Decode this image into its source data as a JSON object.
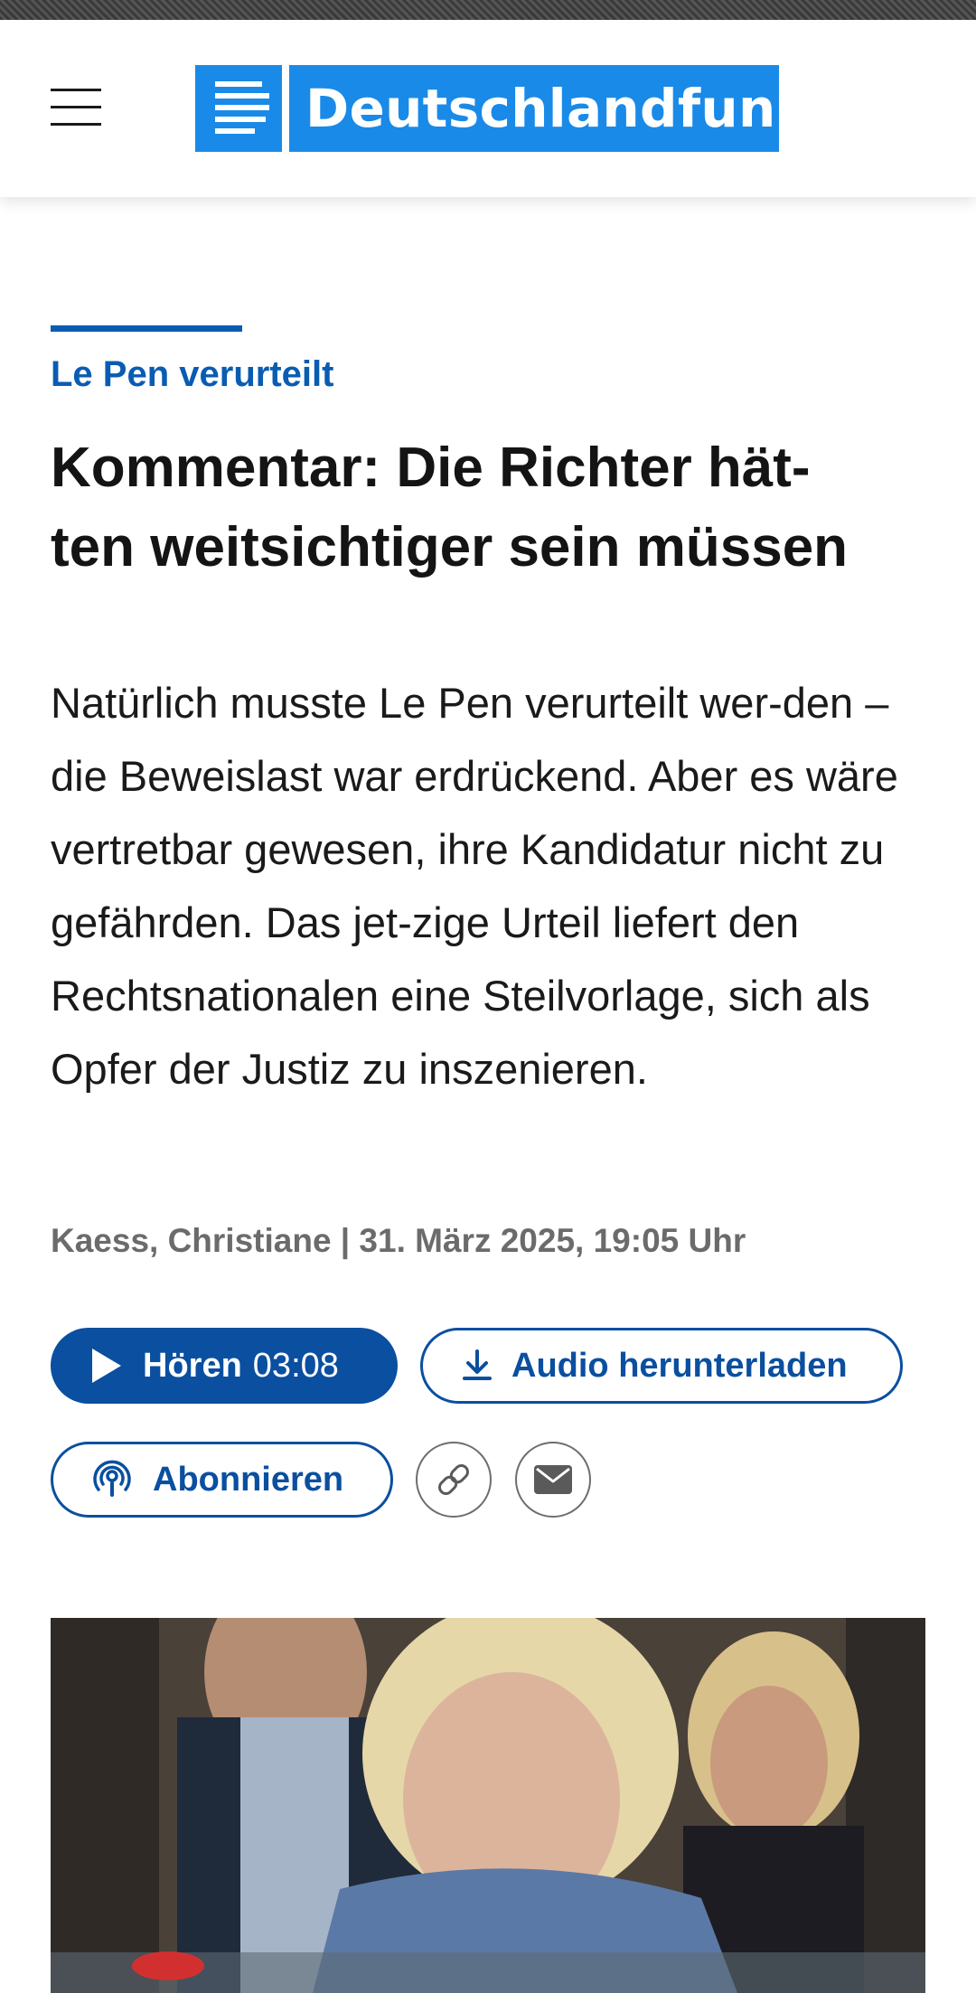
{
  "header": {
    "menu_icon": "hamburger-icon",
    "logo_text": "Deutschlandfunk",
    "logo_color": "#1a8ae8"
  },
  "article": {
    "kicker": "Le Pen verurteilt",
    "headline": "Kommentar: Die Richter hät-ten weitsichtiger sein müssen",
    "headline_lines": [
      "Kommentar: Die Richter hät-",
      "ten weitsichtiger sein müssen"
    ],
    "teaser": "Natürlich musste Le Pen verurteilt wer-den – die Beweislast war erdrückend. Aber es wäre vertretbar gewesen, ihre Kandidatur nicht zu gefährden. Das jet-zige Urteil liefert den Rechtsnationalen eine Steilvorlage, sich als Opfer der Justiz zu inszenieren.",
    "meta": "Kaess, Christiane | 31. März 2025, 19:05 Uhr"
  },
  "actions": {
    "play_label": "Hören",
    "play_duration": "03:08",
    "download_label": "Audio herunterladen",
    "subscribe_label": "Abonnieren",
    "link_icon": "link-icon",
    "mail_icon": "mail-icon"
  },
  "image": {
    "description_icon": "article-photo"
  },
  "colors": {
    "accent": "#0a4fa0",
    "kicker": "#0a5cb3",
    "meta_text": "#6b6b6b"
  }
}
